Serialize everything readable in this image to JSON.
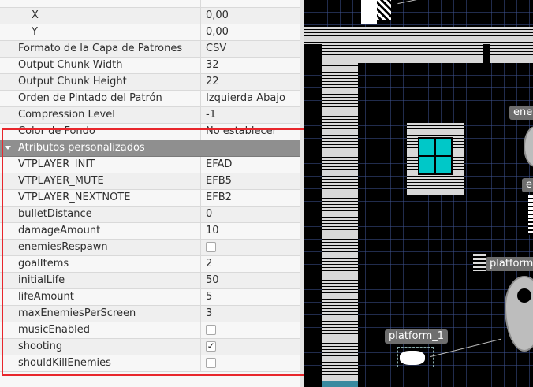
{
  "properties": {
    "top_rows": [
      {
        "name": "",
        "value": "",
        "indent": 1
      },
      {
        "name": "X",
        "value": "0,00",
        "indent": 2
      },
      {
        "name": "Y",
        "value": "0,00",
        "indent": 2
      },
      {
        "name": "Formato de la Capa de Patrones",
        "value": "CSV",
        "indent": 1
      },
      {
        "name": "Output Chunk Width",
        "value": "32",
        "indent": 1
      },
      {
        "name": "Output Chunk Height",
        "value": "22",
        "indent": 1
      },
      {
        "name": "Orden de Pintado del Patrón",
        "value": "Izquierda Abajo",
        "indent": 1
      },
      {
        "name": "Compression Level",
        "value": "-1",
        "indent": 1
      },
      {
        "name": "Color de Fondo",
        "value": "No establecer",
        "indent": 1
      }
    ],
    "group_label": "Atributos personalizados",
    "custom_rows": [
      {
        "name": "VTPLAYER_INIT",
        "value": "EFAD",
        "type": "text"
      },
      {
        "name": "VTPLAYER_MUTE",
        "value": "EFB5",
        "type": "text"
      },
      {
        "name": "VTPLAYER_NEXTNOTE",
        "value": "EFB2",
        "type": "text"
      },
      {
        "name": "bulletDistance",
        "value": "0",
        "type": "text"
      },
      {
        "name": "damageAmount",
        "value": "10",
        "type": "text"
      },
      {
        "name": "enemiesRespawn",
        "value": "",
        "type": "bool",
        "checked": false
      },
      {
        "name": "goalItems",
        "value": "2",
        "type": "text"
      },
      {
        "name": "initialLife",
        "value": "50",
        "type": "text"
      },
      {
        "name": "lifeAmount",
        "value": "5",
        "type": "text"
      },
      {
        "name": "maxEnemiesPerScreen",
        "value": "3",
        "type": "text"
      },
      {
        "name": "musicEnabled",
        "value": "",
        "type": "bool",
        "checked": false
      },
      {
        "name": "shooting",
        "value": "",
        "type": "bool",
        "checked": true
      },
      {
        "name": "shouldKillEnemies",
        "value": "",
        "type": "bool",
        "checked": false
      }
    ],
    "check_mark": "✓"
  },
  "map": {
    "labels": {
      "platform_1": "platform_1",
      "platform_partial": "platform",
      "enemy_partial": "ene",
      "e_partial": "e"
    },
    "colors": {
      "window_cyan": "#00c8c8",
      "highlight_red": "#e8262c"
    }
  }
}
